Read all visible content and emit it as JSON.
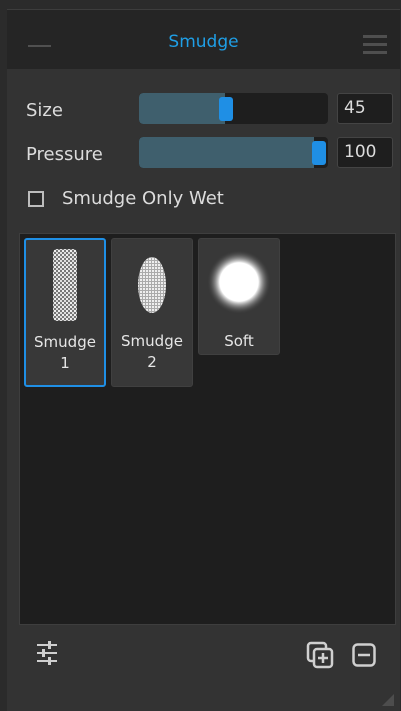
{
  "header": {
    "title": "Smudge"
  },
  "controls": {
    "size": {
      "label": "Size",
      "value": "45",
      "fraction": 0.45
    },
    "pressure": {
      "label": "Pressure",
      "value": "100",
      "fraction": 1.0
    },
    "checkbox": {
      "label": "Smudge Only Wet",
      "checked": false
    }
  },
  "brushes": [
    {
      "name": "Smudge",
      "index": "1",
      "selected": true
    },
    {
      "name": "Smudge",
      "index": "2",
      "selected": false
    },
    {
      "name": "Soft",
      "index": "",
      "selected": false
    }
  ],
  "colors": {
    "accent": "#1f9fe6",
    "panel": "#333333",
    "field": "#1e1e1e"
  },
  "icons": {
    "collapse": "minus-icon",
    "menu": "hamburger-menu-icon",
    "settings": "sliders-icon",
    "duplicate": "duplicate-icon",
    "remove": "remove-icon"
  }
}
